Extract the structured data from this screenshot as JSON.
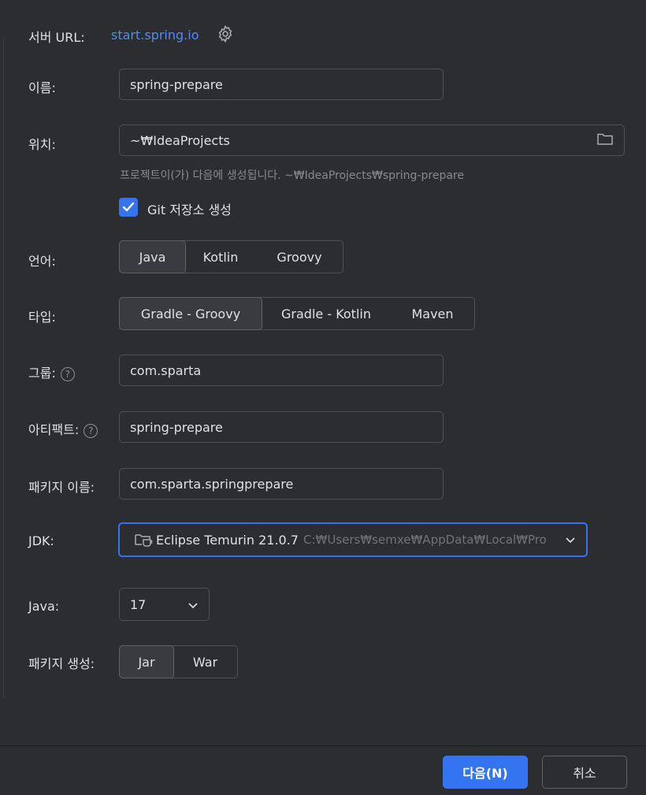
{
  "server": {
    "label": "서버 URL:",
    "url": "start.spring.io"
  },
  "name": {
    "label": "이름:",
    "value": "spring-prepare"
  },
  "location": {
    "label": "위치:",
    "value": "~₩IdeaProjects",
    "hint": "프로젝트이(가) 다음에 생성됩니다. ~₩IdeaProjects₩spring-prepare"
  },
  "git": {
    "label": "Git 저장소 생성",
    "checked": true
  },
  "language": {
    "label": "언어:",
    "options": [
      "Java",
      "Kotlin",
      "Groovy"
    ],
    "selected": "Java"
  },
  "type": {
    "label": "타입:",
    "options": [
      "Gradle - Groovy",
      "Gradle - Kotlin",
      "Maven"
    ],
    "selected": "Gradle - Groovy"
  },
  "group": {
    "label": "그룹:",
    "value": "com.sparta"
  },
  "artifact": {
    "label": "아티팩트:",
    "value": "spring-prepare"
  },
  "package_name": {
    "label": "패키지 이름:",
    "value": "com.sparta.springprepare"
  },
  "jdk": {
    "label": "JDK:",
    "name": "Eclipse Temurin 21.0.7",
    "path": "C:₩Users₩semxe₩AppData₩Local₩Pro"
  },
  "java": {
    "label": "Java:",
    "value": "17"
  },
  "packaging": {
    "label": "패키지 생성:",
    "options": [
      "Jar",
      "War"
    ],
    "selected": "Jar"
  },
  "footer": {
    "next": "다음(N)",
    "cancel": "취소"
  },
  "colors": {
    "accent": "#3574f0",
    "link": "#548af7",
    "background": "#2b2d30"
  }
}
